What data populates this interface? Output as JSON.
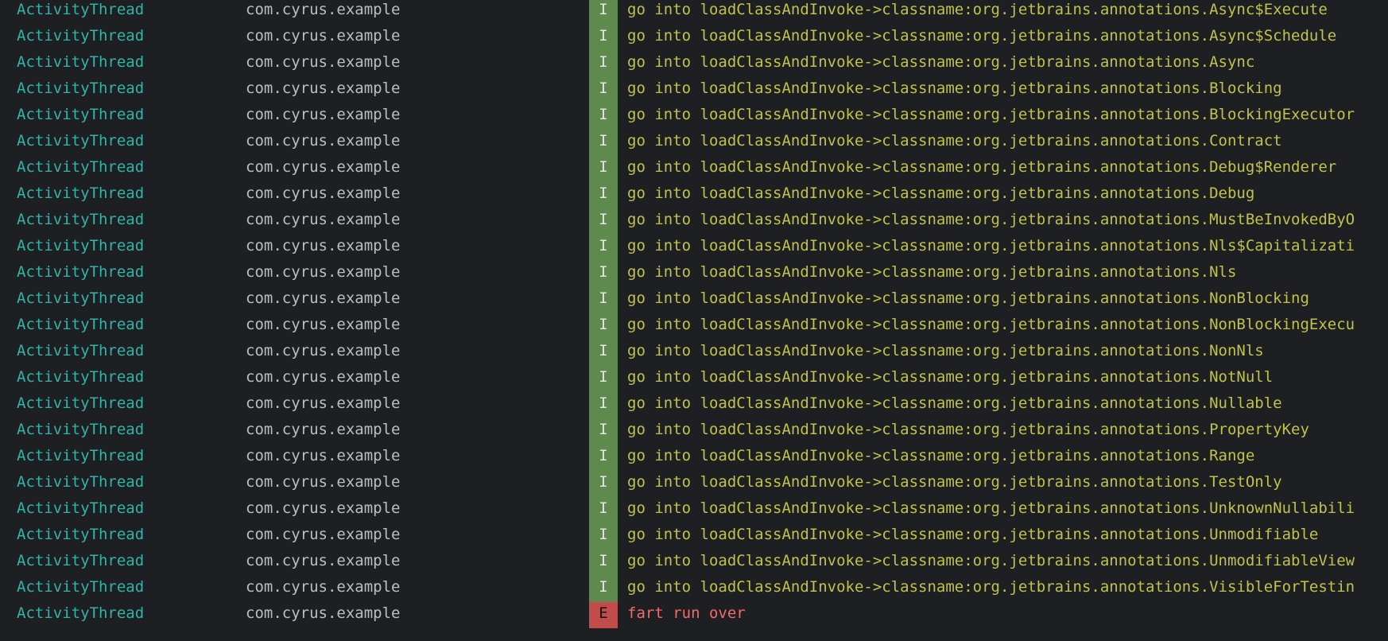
{
  "colors": {
    "background": "#1e1f22",
    "tag": "#2fb5a8",
    "package": "#bcbec4",
    "info_badge": "#5f8a4e",
    "error_badge": "#c24b4b",
    "info_text": "#bfc34a",
    "error_text": "#f06b6b"
  },
  "log_rows": [
    {
      "tag": "ActivityThread",
      "package": "com.cyrus.example",
      "level": "I",
      "message": "go into loadClassAndInvoke->classname:org.jetbrains.annotations.Async$Execute"
    },
    {
      "tag": "ActivityThread",
      "package": "com.cyrus.example",
      "level": "I",
      "message": "go into loadClassAndInvoke->classname:org.jetbrains.annotations.Async$Schedule"
    },
    {
      "tag": "ActivityThread",
      "package": "com.cyrus.example",
      "level": "I",
      "message": "go into loadClassAndInvoke->classname:org.jetbrains.annotations.Async"
    },
    {
      "tag": "ActivityThread",
      "package": "com.cyrus.example",
      "level": "I",
      "message": "go into loadClassAndInvoke->classname:org.jetbrains.annotations.Blocking"
    },
    {
      "tag": "ActivityThread",
      "package": "com.cyrus.example",
      "level": "I",
      "message": "go into loadClassAndInvoke->classname:org.jetbrains.annotations.BlockingExecutor"
    },
    {
      "tag": "ActivityThread",
      "package": "com.cyrus.example",
      "level": "I",
      "message": "go into loadClassAndInvoke->classname:org.jetbrains.annotations.Contract"
    },
    {
      "tag": "ActivityThread",
      "package": "com.cyrus.example",
      "level": "I",
      "message": "go into loadClassAndInvoke->classname:org.jetbrains.annotations.Debug$Renderer"
    },
    {
      "tag": "ActivityThread",
      "package": "com.cyrus.example",
      "level": "I",
      "message": "go into loadClassAndInvoke->classname:org.jetbrains.annotations.Debug"
    },
    {
      "tag": "ActivityThread",
      "package": "com.cyrus.example",
      "level": "I",
      "message": "go into loadClassAndInvoke->classname:org.jetbrains.annotations.MustBeInvokedByO"
    },
    {
      "tag": "ActivityThread",
      "package": "com.cyrus.example",
      "level": "I",
      "message": "go into loadClassAndInvoke->classname:org.jetbrains.annotations.Nls$Capitalizati"
    },
    {
      "tag": "ActivityThread",
      "package": "com.cyrus.example",
      "level": "I",
      "message": "go into loadClassAndInvoke->classname:org.jetbrains.annotations.Nls"
    },
    {
      "tag": "ActivityThread",
      "package": "com.cyrus.example",
      "level": "I",
      "message": "go into loadClassAndInvoke->classname:org.jetbrains.annotations.NonBlocking"
    },
    {
      "tag": "ActivityThread",
      "package": "com.cyrus.example",
      "level": "I",
      "message": "go into loadClassAndInvoke->classname:org.jetbrains.annotations.NonBlockingExecu"
    },
    {
      "tag": "ActivityThread",
      "package": "com.cyrus.example",
      "level": "I",
      "message": "go into loadClassAndInvoke->classname:org.jetbrains.annotations.NonNls"
    },
    {
      "tag": "ActivityThread",
      "package": "com.cyrus.example",
      "level": "I",
      "message": "go into loadClassAndInvoke->classname:org.jetbrains.annotations.NotNull"
    },
    {
      "tag": "ActivityThread",
      "package": "com.cyrus.example",
      "level": "I",
      "message": "go into loadClassAndInvoke->classname:org.jetbrains.annotations.Nullable"
    },
    {
      "tag": "ActivityThread",
      "package": "com.cyrus.example",
      "level": "I",
      "message": "go into loadClassAndInvoke->classname:org.jetbrains.annotations.PropertyKey"
    },
    {
      "tag": "ActivityThread",
      "package": "com.cyrus.example",
      "level": "I",
      "message": "go into loadClassAndInvoke->classname:org.jetbrains.annotations.Range"
    },
    {
      "tag": "ActivityThread",
      "package": "com.cyrus.example",
      "level": "I",
      "message": "go into loadClassAndInvoke->classname:org.jetbrains.annotations.TestOnly"
    },
    {
      "tag": "ActivityThread",
      "package": "com.cyrus.example",
      "level": "I",
      "message": "go into loadClassAndInvoke->classname:org.jetbrains.annotations.UnknownNullabili"
    },
    {
      "tag": "ActivityThread",
      "package": "com.cyrus.example",
      "level": "I",
      "message": "go into loadClassAndInvoke->classname:org.jetbrains.annotations.Unmodifiable"
    },
    {
      "tag": "ActivityThread",
      "package": "com.cyrus.example",
      "level": "I",
      "message": "go into loadClassAndInvoke->classname:org.jetbrains.annotations.UnmodifiableView"
    },
    {
      "tag": "ActivityThread",
      "package": "com.cyrus.example",
      "level": "I",
      "message": "go into loadClassAndInvoke->classname:org.jetbrains.annotations.VisibleForTestin"
    },
    {
      "tag": "ActivityThread",
      "package": "com.cyrus.example",
      "level": "E",
      "message": "fart run over"
    }
  ]
}
